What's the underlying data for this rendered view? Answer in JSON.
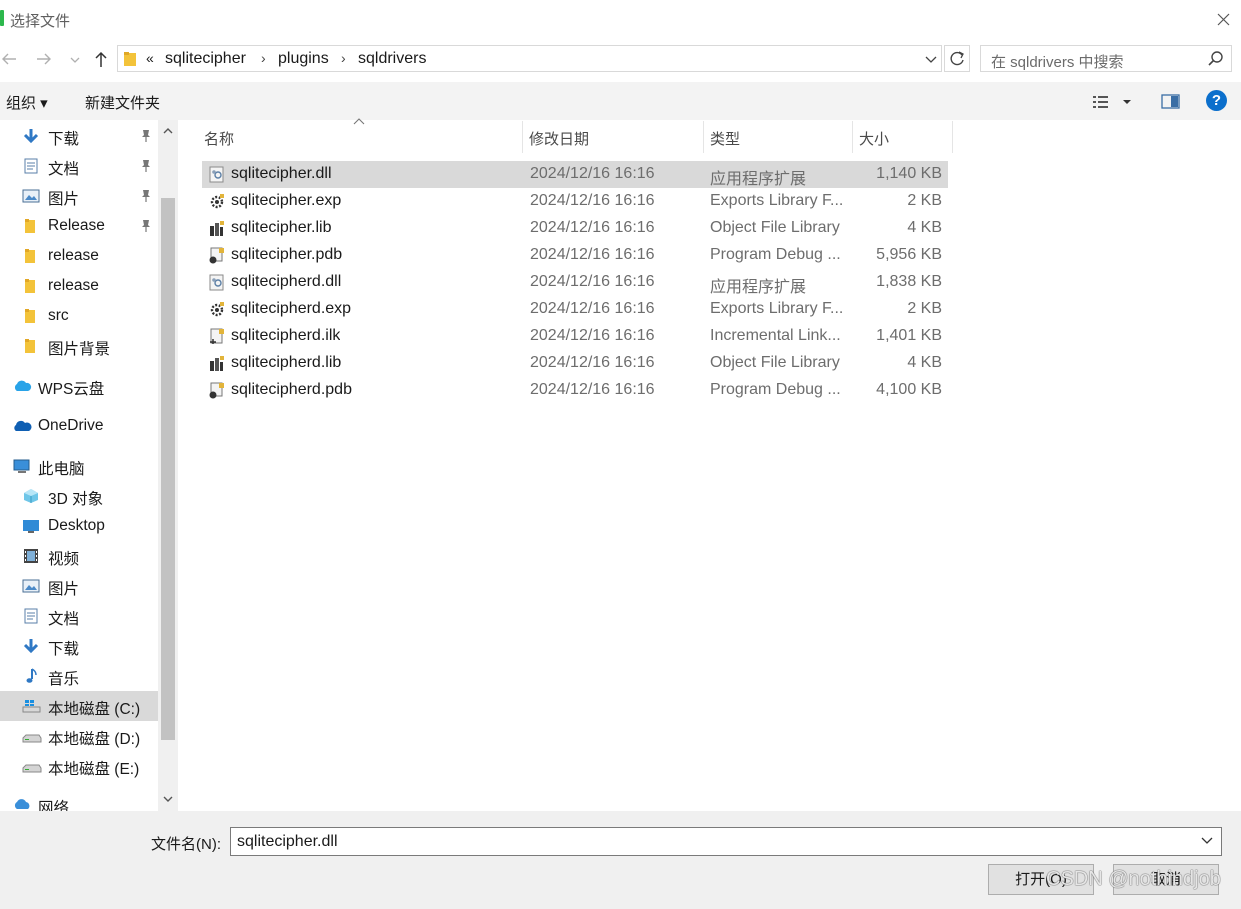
{
  "window": {
    "title": "选择文件"
  },
  "address": {
    "overflow": "«",
    "crumbs": [
      "sqlitecipher",
      "plugins",
      "sqldrivers"
    ]
  },
  "search": {
    "placeholder": "在 sqldrivers 中搜索"
  },
  "toolbar": {
    "organize": "组织 ▾",
    "new_folder": "新建文件夹"
  },
  "nav": {
    "items": [
      {
        "label": "下载",
        "icon": "download-arrow-icon",
        "pinned": true
      },
      {
        "label": "文档",
        "icon": "document-icon",
        "pinned": true
      },
      {
        "label": "图片",
        "icon": "picture-icon",
        "pinned": true
      },
      {
        "label": "Release",
        "icon": "folder-icon",
        "pinned": true
      },
      {
        "label": "release",
        "icon": "folder-icon",
        "pinned": false
      },
      {
        "label": "release",
        "icon": "folder-icon",
        "pinned": false
      },
      {
        "label": "src",
        "icon": "folder-icon",
        "pinned": false
      },
      {
        "label": "图片背景",
        "icon": "folder-icon",
        "pinned": false
      },
      {
        "label": "WPS云盘",
        "icon": "cloud-icon",
        "pinned": false
      },
      {
        "label": "OneDrive",
        "icon": "onedrive-cloud-icon",
        "pinned": false
      },
      {
        "label": "此电脑",
        "icon": "computer-icon",
        "pinned": false
      },
      {
        "label": "3D 对象",
        "icon": "3d-cube-icon",
        "pinned": false
      },
      {
        "label": "Desktop",
        "icon": "desktop-icon",
        "pinned": false
      },
      {
        "label": "视频",
        "icon": "video-icon",
        "pinned": false
      },
      {
        "label": "图片",
        "icon": "picture-icon",
        "pinned": false
      },
      {
        "label": "文档",
        "icon": "document-icon",
        "pinned": false
      },
      {
        "label": "下载",
        "icon": "download-arrow-icon",
        "pinned": false
      },
      {
        "label": "音乐",
        "icon": "music-note-icon",
        "pinned": false
      },
      {
        "label": "本地磁盘 (C:)",
        "icon": "drive-c-icon",
        "pinned": false,
        "selected": true
      },
      {
        "label": "本地磁盘 (D:)",
        "icon": "drive-icon",
        "pinned": false
      },
      {
        "label": "本地磁盘 (E:)",
        "icon": "drive-icon",
        "pinned": false
      },
      {
        "label": "网络",
        "icon": "network-icon",
        "pinned": false
      }
    ]
  },
  "columns": {
    "name": "名称",
    "date": "修改日期",
    "type": "类型",
    "size": "大小"
  },
  "files": [
    {
      "name": "sqlitecipher.dll",
      "date": "2024/12/16 16:16",
      "type": "应用程序扩展",
      "size": "1,140 KB",
      "icon": "dll-icon",
      "selected": true
    },
    {
      "name": "sqlitecipher.exp",
      "date": "2024/12/16 16:16",
      "type": "Exports Library F...",
      "size": "2 KB",
      "icon": "exp-gear-icon"
    },
    {
      "name": "sqlitecipher.lib",
      "date": "2024/12/16 16:16",
      "type": "Object File Library",
      "size": "4 KB",
      "icon": "lib-icon"
    },
    {
      "name": "sqlitecipher.pdb",
      "date": "2024/12/16 16:16",
      "type": "Program Debug ...",
      "size": "5,956 KB",
      "icon": "pdb-icon"
    },
    {
      "name": "sqlitecipherd.dll",
      "date": "2024/12/16 16:16",
      "type": "应用程序扩展",
      "size": "1,838 KB",
      "icon": "dll-icon"
    },
    {
      "name": "sqlitecipherd.exp",
      "date": "2024/12/16 16:16",
      "type": "Exports Library F...",
      "size": "2 KB",
      "icon": "exp-gear-icon"
    },
    {
      "name": "sqlitecipherd.ilk",
      "date": "2024/12/16 16:16",
      "type": "Incremental Link...",
      "size": "1,401 KB",
      "icon": "ilk-icon"
    },
    {
      "name": "sqlitecipherd.lib",
      "date": "2024/12/16 16:16",
      "type": "Object File Library",
      "size": "4 KB",
      "icon": "lib-icon"
    },
    {
      "name": "sqlitecipherd.pdb",
      "date": "2024/12/16 16:16",
      "type": "Program Debug ...",
      "size": "4,100 KB",
      "icon": "pdb-icon"
    }
  ],
  "bottom": {
    "filename_label": "文件名(N):",
    "filename_value": "sqlitecipher.dll",
    "open_label": "打开(O)",
    "cancel_label": "取消"
  },
  "watermark": "CSDN @nothindjob"
}
